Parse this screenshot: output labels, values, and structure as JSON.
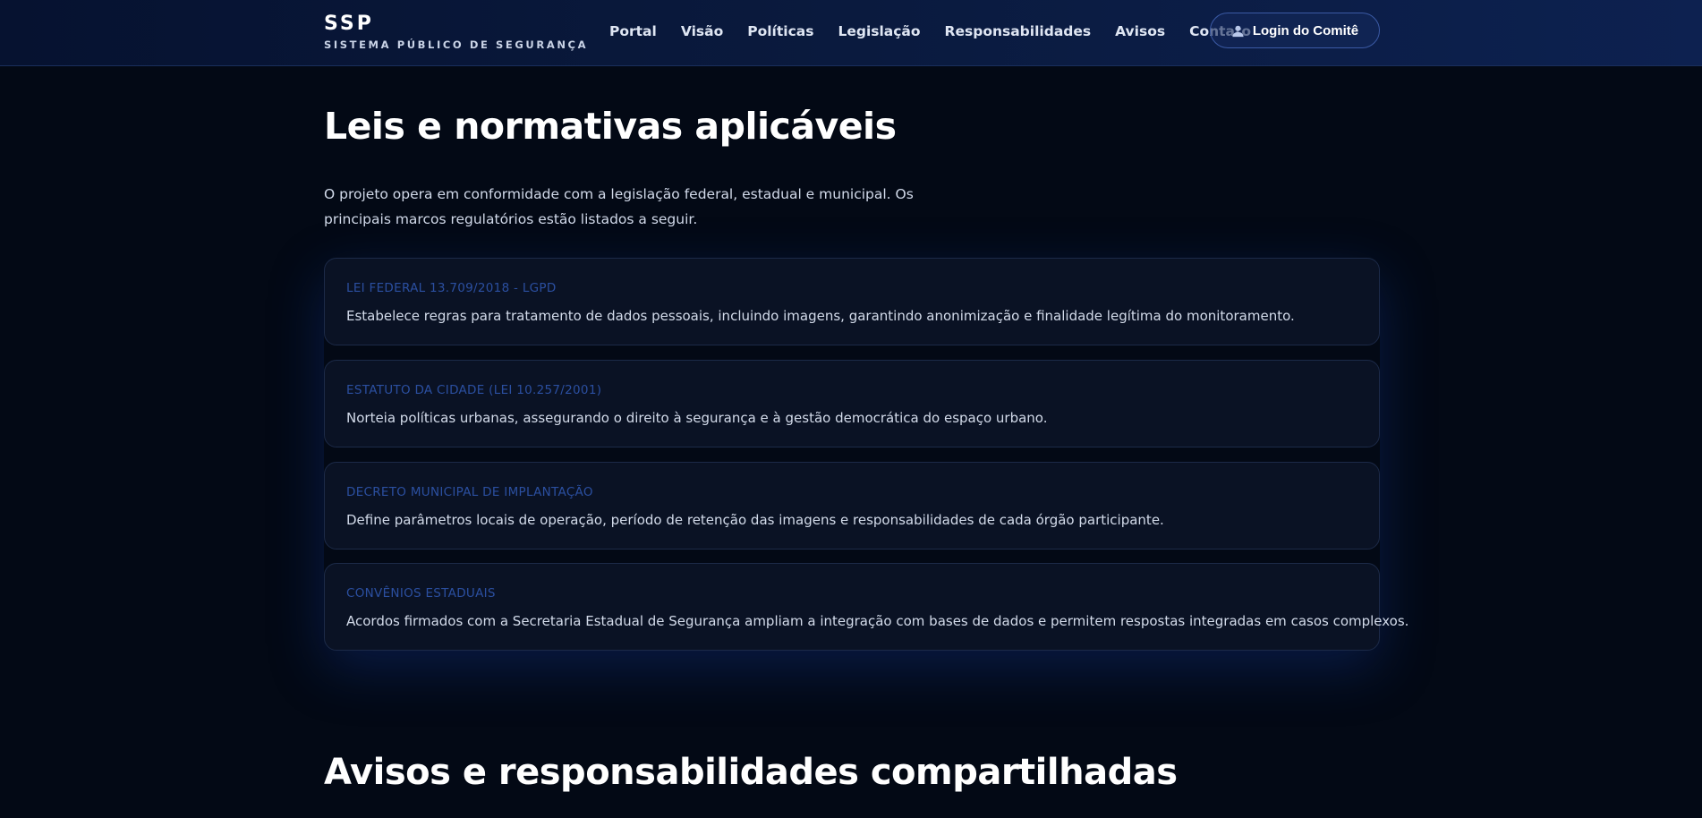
{
  "brand": {
    "title": "SSP",
    "subtitle": "SISTEMA PÚBLICO DE SEGURANÇA"
  },
  "nav": {
    "items": [
      "Portal",
      "Visão",
      "Políticas",
      "Legislação",
      "Responsabilidades",
      "Avisos",
      "Contato"
    ],
    "login_label": "Login do Comitê",
    "login_icon": "user-icon"
  },
  "main": {
    "title": "Leis e normativas aplicáveis",
    "intro": "O projeto opera em conformidade com a legislação federal, estadual e municipal. Os principais marcos regulatórios estão listados a seguir.",
    "cards": [
      {
        "title": "LEI FEDERAL 13.709/2018 - LGPD",
        "text": "Estabelece regras para tratamento de dados pessoais, incluindo imagens, garantindo anonimização e finalidade legítima do monitoramento."
      },
      {
        "title": "ESTATUTO DA CIDADE (LEI 10.257/2001)",
        "text": "Norteia políticas urbanas, assegurando o direito à segurança e à gestão democrática do espaço urbano."
      },
      {
        "title": "DECRETO MUNICIPAL DE IMPLANTAÇÃO",
        "text": "Define parâmetros locais de operação, período de retenção das imagens e responsabilidades de cada órgão participante."
      },
      {
        "title": "CONVÊNIOS ESTADUAIS",
        "text": "Acordos firmados com a Secretaria Estadual de Segurança ampliam a integração com bases de dados e permitem respostas integradas em casos complexos."
      }
    ],
    "next_section_title": "Avisos e responsabilidades compartilhadas"
  },
  "colors": {
    "background": "#030915",
    "header": "#0a1a3e",
    "card_title": "#2b4fa0",
    "card_background": "#0a1224"
  }
}
